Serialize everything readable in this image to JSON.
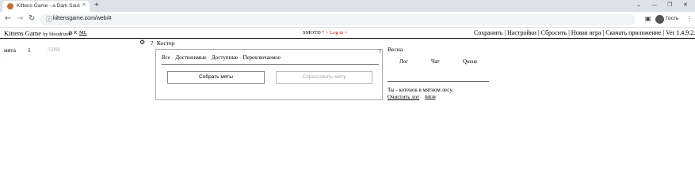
{
  "browser": {
    "tab_title": "Kittens Game - a Dark Souls of incremental games",
    "tab_close": "×",
    "new_tab": "+",
    "url": "kittensgame.com/web/#",
    "guest_label": "Гость",
    "window_controls": [
      "⌄",
      "—",
      "❐",
      "✕"
    ],
    "nav_icons": [
      "arrow-left-icon",
      "arrow-right-icon",
      "reload-icon"
    ]
  },
  "game_bar": {
    "title": "Kittens Game",
    "by": "by bloodrizer",
    "small_links": [
      "⚙",
      "R",
      "ML"
    ],
    "motd": "SMOTD",
    "login": "* > Log in <",
    "menu": "Сохранить | Настройки | Сбросить | Новая игра | Скачать приложение | Ver 1.4.9.2.r1247"
  },
  "resources": {
    "name": "мята",
    "value": "1",
    "max": "/5000"
  },
  "center": {
    "help": "?",
    "tab_title": "Костер",
    "filters": [
      "Все",
      "Достижимые",
      "Доступные",
      "Переключаемое"
    ],
    "gather_button": "Собрать мяты",
    "refine_button": "Спрессовать мяту"
  },
  "right": {
    "season": "Весна",
    "tabs": [
      "Лог",
      "Чат",
      "Queue"
    ],
    "log_message": "Ты - котенок в мятном лесу.",
    "clear_log": "Очистить лог",
    "pause": "пауза"
  }
}
